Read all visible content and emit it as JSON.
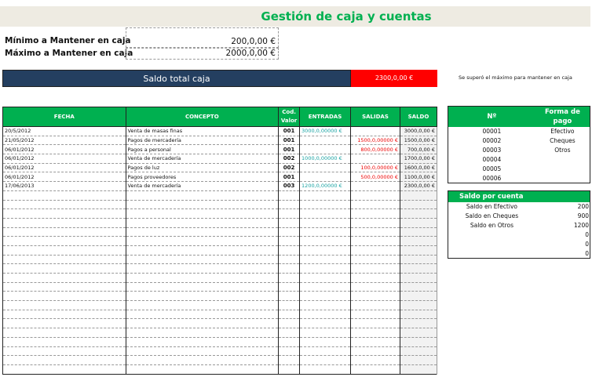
{
  "title": "Gestión de caja y cuentas",
  "limits": {
    "min_label": "Mínimo a Mantener en caja",
    "min_value": "200,0,00 €",
    "max_label": "Máximo a Mantener en caja",
    "max_value": "2000,0,00 €"
  },
  "saldo": {
    "label": "Saldo total caja",
    "value": "2300,0,00 €",
    "warning": "Se superó el máximo para mantener en caja"
  },
  "colors": {
    "header_green": "#00b050",
    "navy": "#243f60",
    "alert_red": "#ff0000",
    "income": "#17a2a2",
    "expense": "#e00000"
  },
  "main": {
    "headers": [
      "FECHA",
      "CONCEPTO",
      "Cod. Valor",
      "ENTRADAS",
      "SALIDAS",
      "SALDO"
    ],
    "rows": [
      [
        "20/5/2012",
        "Venta de masas finas",
        "001",
        "3000,0,00000 €",
        "",
        "3000,0,00 €"
      ],
      [
        "21/05/2012",
        "Pagos de mercadería",
        "001",
        "",
        "1500,0,00000 €",
        "1500,0,00 €"
      ],
      [
        "06/01/2012",
        "Pagos a personal",
        "001",
        "",
        "800,0,00000 €",
        "700,0,00 €"
      ],
      [
        "06/01/2012",
        "Venta de mercadería",
        "002",
        "1000,0,00000 €",
        "",
        "1700,0,00 €"
      ],
      [
        "06/01/2012",
        "Pagos de luz",
        "002",
        "",
        "100,0,00000 €",
        "1600,0,00 €"
      ],
      [
        "06/01/2012",
        "Pagos proveedores",
        "001",
        "",
        "500,0,00000 €",
        "1100,0,00 €"
      ],
      [
        "17/06/2013",
        "Venta de mercadería",
        "003",
        "1200,0,00000 €",
        "",
        "2300,0,00 €"
      ]
    ]
  },
  "payment": {
    "headers": [
      "Nº",
      "Forma de pago"
    ],
    "rows": [
      [
        "00001",
        "Efectivo"
      ],
      [
        "00002",
        "Cheques"
      ],
      [
        "00003",
        "Otros"
      ],
      [
        "00004",
        ""
      ],
      [
        "00005",
        ""
      ],
      [
        "00006",
        ""
      ]
    ]
  },
  "accounts": {
    "title": "Saldo por cuenta",
    "rows": [
      [
        "Saldo en Efectivo",
        "200"
      ],
      [
        "Saldo en Cheques",
        "900"
      ],
      [
        "Saldo en Otros",
        "1200"
      ],
      [
        "",
        "0"
      ],
      [
        "",
        "0"
      ],
      [
        "",
        "0"
      ]
    ]
  }
}
